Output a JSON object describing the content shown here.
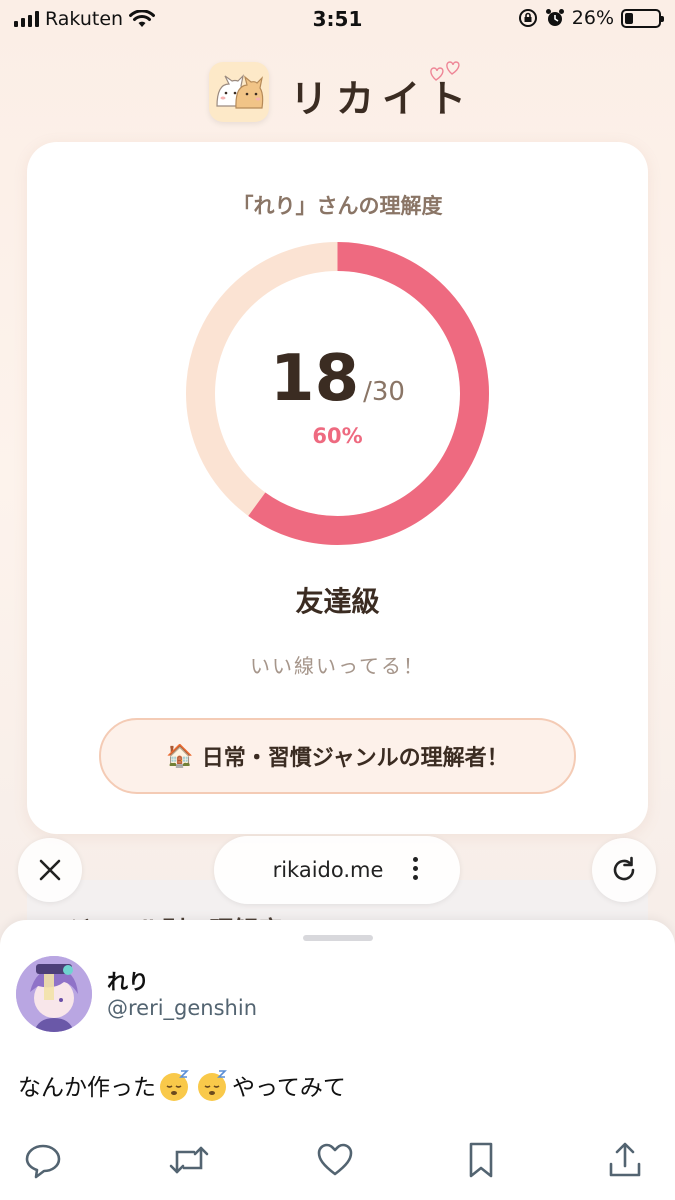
{
  "status_bar": {
    "carrier": "Rakuten",
    "time": "3:51",
    "battery": "26%"
  },
  "app": {
    "title": "リカイト"
  },
  "result_card": {
    "subtitle": "「れり」さんの理解度",
    "score": "18",
    "total": "/30",
    "percent": "60%",
    "progress_fraction": 0.6,
    "level": "友達級",
    "level_message": "いい線いってる！",
    "genre_emoji": "🏠",
    "genre_label": "日常・習慣ジャンルの理解者！"
  },
  "browser": {
    "url": "rikaido.me",
    "behind_text": "ジャンル別の理解度"
  },
  "tweet": {
    "display_name": "れり",
    "handle": "@reri_genshin",
    "text_before": "なんか作った",
    "text_after": "やってみて"
  },
  "colors": {
    "accent": "#ee6a80",
    "track": "#fbe3d3",
    "text_dark": "#3b2c22",
    "text_muted": "#8a7566"
  }
}
